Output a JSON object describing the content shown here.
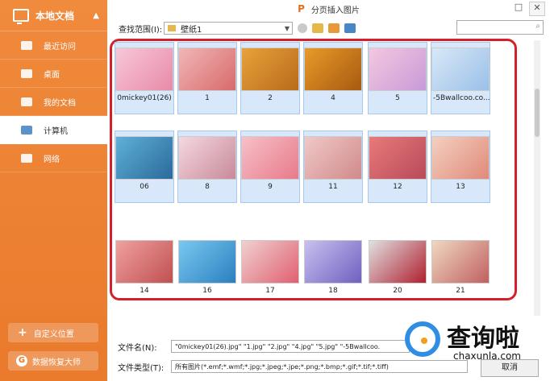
{
  "sidebar": {
    "title": "本地文档",
    "items": [
      {
        "label": "最近访问"
      },
      {
        "label": "桌面"
      },
      {
        "label": "我的文档"
      },
      {
        "label": "计算机"
      },
      {
        "label": "网络"
      }
    ],
    "custom_location": "自定义位置",
    "recovery": "数据恢复大师"
  },
  "dialog": {
    "title": "分页插入图片",
    "logo": "P"
  },
  "toolbar": {
    "scope_label": "查找范围(I):",
    "scope_value": "壁纸1"
  },
  "files": [
    {
      "name": "0mickey01(26)",
      "selected": true
    },
    {
      "name": "1",
      "selected": true
    },
    {
      "name": "2",
      "selected": true
    },
    {
      "name": "4",
      "selected": true
    },
    {
      "name": "5",
      "selected": true
    },
    {
      "name": "-5Bwallcoo.co...",
      "selected": true
    },
    {
      "name": "06",
      "selected": true
    },
    {
      "name": "8",
      "selected": true
    },
    {
      "name": "9",
      "selected": true
    },
    {
      "name": "11",
      "selected": true
    },
    {
      "name": "12",
      "selected": true
    },
    {
      "name": "13",
      "selected": true
    },
    {
      "name": "14",
      "selected": false
    },
    {
      "name": "16",
      "selected": false
    },
    {
      "name": "17",
      "selected": false
    },
    {
      "name": "18",
      "selected": false
    },
    {
      "name": "20",
      "selected": false
    },
    {
      "name": "21",
      "selected": false
    }
  ],
  "filename": {
    "label": "文件名(N):",
    "value": "\"0mickey01(26).jpg\" \"1.jpg\" \"2.jpg\" \"4.jpg\" \"5.jpg\" \"-5Bwallcoo."
  },
  "filetype": {
    "label": "文件类型(T):",
    "value": "所有图片(*.emf;*.wmf;*.jpg;*.jpeg;*.jpe;*.png;*.bmp;*.gif;*.tif;*.tiff)"
  },
  "cancel_label": "取消",
  "watermark": {
    "text": "查询啦",
    "url": "chaxunla.com"
  },
  "colors": {
    "accent": "#ea7a2c",
    "highlight": "#d4202a",
    "selection": "#d8e8fa"
  }
}
